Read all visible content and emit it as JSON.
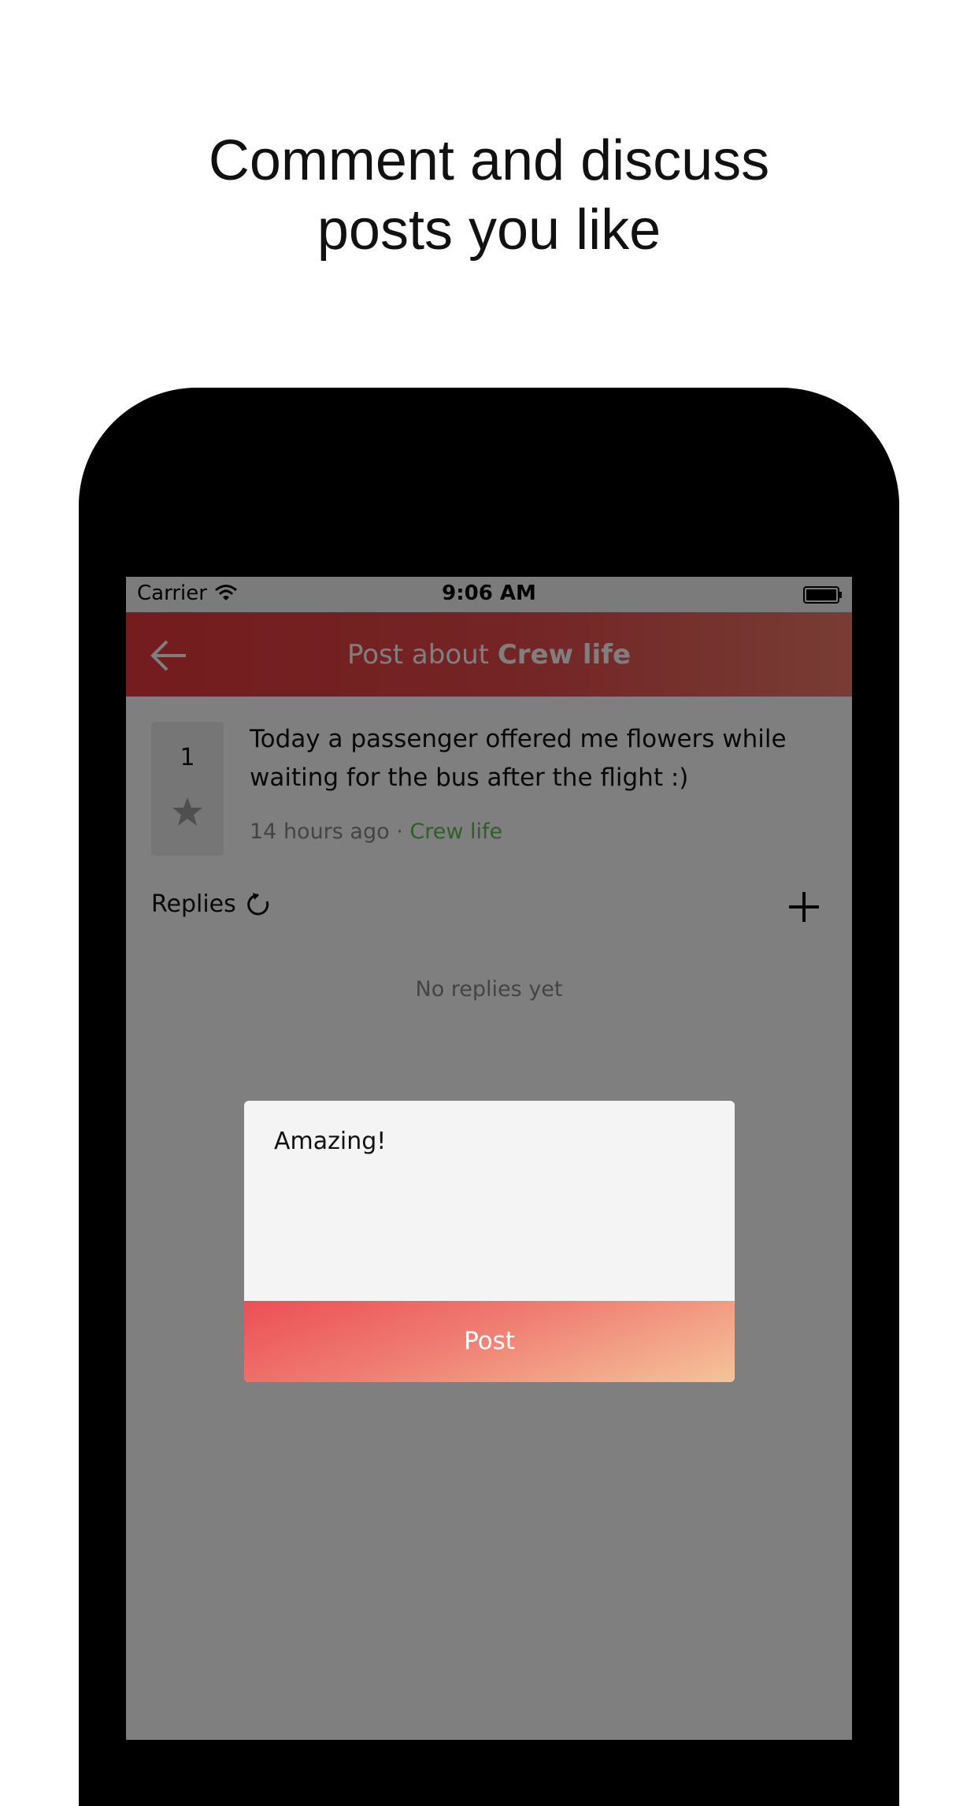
{
  "headline": {
    "line1": "Comment and discuss",
    "line2": "posts you like"
  },
  "status_bar": {
    "carrier": "Carrier",
    "time": "9:06 AM"
  },
  "nav": {
    "title_prefix": "Post about ",
    "title_category": "Crew life"
  },
  "post": {
    "vote_count": "1",
    "text": "Today a passenger offered me flowers while waiting for the bus after the flight :)",
    "time_ago": "14 hours ago",
    "separator": " · ",
    "category": "Crew life"
  },
  "replies": {
    "label": "Replies",
    "empty_text": "No replies yet"
  },
  "reply_dialog": {
    "input_value": "Amazing!",
    "post_label": "Post"
  },
  "colors": {
    "nav_accent": "#e8383d",
    "category_green": "#5cbf52",
    "post_button_start": "#ec4f55",
    "post_button_end": "#f5c49a"
  }
}
